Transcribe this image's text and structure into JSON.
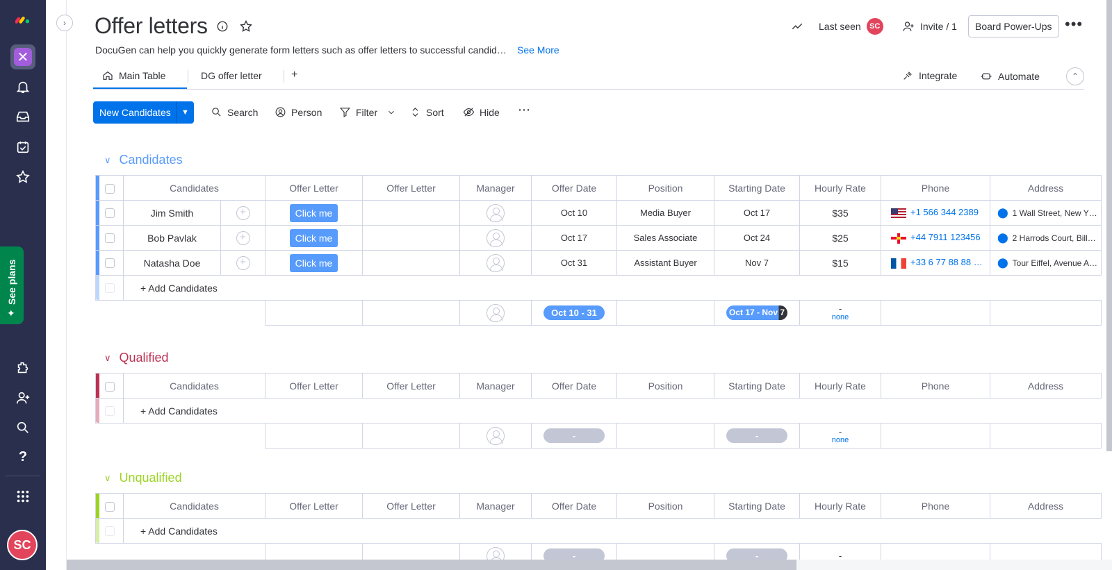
{
  "app": {
    "see_plans": "See plans",
    "user_initials": "SC"
  },
  "board": {
    "title": "Offer letters",
    "description": "DocuGen can help you quickly generate form letters such as offer letters to successful candid…",
    "see_more": "See More",
    "last_seen": "Last seen",
    "invite": "Invite / 1",
    "power_ups": "Board Power-Ups"
  },
  "tabs": {
    "main": "Main Table",
    "dg": "DG offer letter",
    "add": "+",
    "integrate": "Integrate",
    "automate": "Automate"
  },
  "toolbar": {
    "new_item": "New Candidates",
    "search": "Search",
    "person": "Person",
    "filter": "Filter",
    "sort": "Sort",
    "hide": "Hide"
  },
  "columns": [
    "Candidates",
    "Offer Letter",
    "Offer Letter",
    "Manager",
    "Offer Date",
    "Position",
    "Starting Date",
    "Hourly Rate",
    "Phone",
    "Address"
  ],
  "colors": {
    "candidates": "#579bfc",
    "qualified": "#bb3354",
    "unqualified": "#9cd326",
    "accent": "#0073ea"
  },
  "groups": [
    {
      "title": "Candidates",
      "rows": [
        {
          "name": "Jim Smith",
          "button": "Click me",
          "offer_date": "Oct 10",
          "position": "Media Buyer",
          "start": "Oct 17",
          "rate": "$35",
          "phone": "+1 566 344 2389",
          "flag": "us-flag-icon",
          "address": "1 Wall Street, New Y…"
        },
        {
          "name": "Bob Pavlak",
          "button": "Click me",
          "offer_date": "Oct 17",
          "position": "Sales Associate",
          "start": "Oct 24",
          "rate": "$25",
          "phone": "+44 7911 123456",
          "flag": "guernsey-flag-icon",
          "address": "2 Harrods Court, Bill…"
        },
        {
          "name": "Natasha Doe",
          "button": "Click me",
          "offer_date": "Oct 31",
          "position": "Assistant Buyer",
          "start": "Nov 7",
          "rate": "$15",
          "phone": "+33 6 77 88 88 …",
          "flag": "france-flag-icon",
          "address": "Tour Eiffel, Avenue A…"
        }
      ],
      "add_label": "+ Add Candidates",
      "summary": {
        "offer_range": "Oct 10 - 31",
        "start_range": "Oct 17 - Nov 7",
        "rate_dash": "-",
        "rate_none": "none"
      }
    },
    {
      "title": "Qualified",
      "add_label": "+ Add Candidates",
      "summary": {
        "offer_range": "-",
        "start_range": "-",
        "rate_dash": "-",
        "rate_none": "none"
      }
    },
    {
      "title": "Unqualified",
      "add_label": "+ Add Candidates",
      "summary": {
        "offer_range": "-",
        "start_range": "-",
        "rate_dash": "-"
      }
    }
  ]
}
